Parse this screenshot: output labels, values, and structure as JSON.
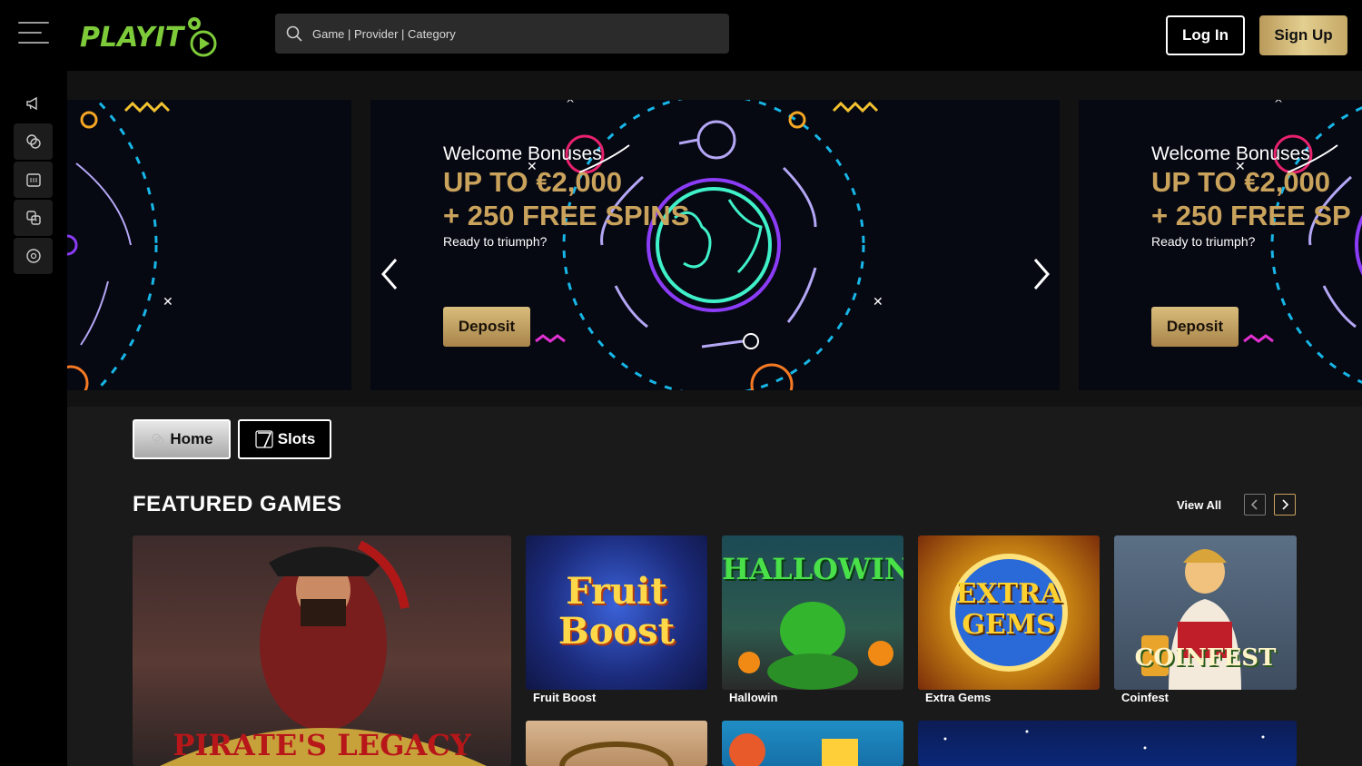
{
  "header": {
    "search_placeholder": "Game | Provider | Category",
    "login_label": "Log In",
    "signup_label": "Sign Up",
    "logo_text": "PLAYIT"
  },
  "sidebar": {
    "items": [
      {
        "icon": "megaphone-icon"
      },
      {
        "icon": "casino-chips-icon"
      },
      {
        "icon": "slot-machine-icon"
      },
      {
        "icon": "dice-icon"
      },
      {
        "icon": "settings-wheel-icon"
      }
    ]
  },
  "banner": {
    "slides": [
      {
        "heading": "Welcome Bonuses",
        "line1": "UP TO €2,000",
        "line2": "+ 250 FREE SPINS",
        "tagline": "Ready to triumph?",
        "cta": "Deposit"
      },
      {
        "heading": "Welcome Bonuses",
        "line1": "UP TO €2,000",
        "line2": "+ 250 FREE SP",
        "tagline": "Ready to triumph?",
        "cta": "Deposit"
      }
    ]
  },
  "tabs": [
    {
      "label": "Home",
      "active": true
    },
    {
      "label": "Slots",
      "active": false
    }
  ],
  "featured": {
    "title": "FEATURED GAMES",
    "view_all": "View All",
    "games": [
      {
        "title": "Fruit Boost",
        "art": "Fruit Boost"
      },
      {
        "title": "Hallowin",
        "art": "HALLOWIN"
      },
      {
        "title": "Extra Gems",
        "art": "EXTRA GEMS"
      },
      {
        "title": "Coinfest",
        "art": "COINFEST"
      }
    ],
    "large_game_art": "PIRATE'S LEGACY"
  },
  "colors": {
    "accent_gold": "#c9a25c",
    "brand_green": "#7ecb3a",
    "banner_cyan": "#17b6e6",
    "banner_purple": "#8b3cf7"
  }
}
